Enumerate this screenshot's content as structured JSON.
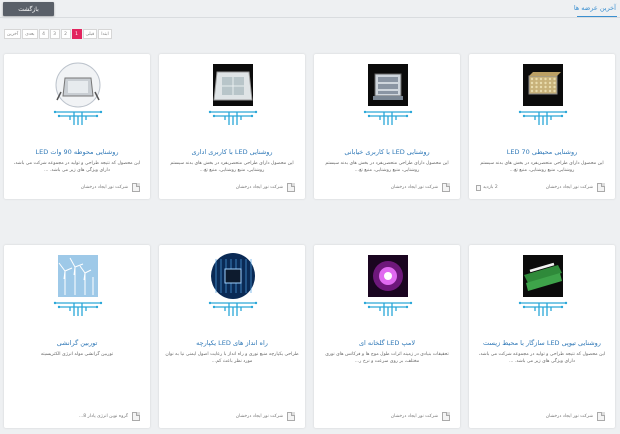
{
  "header": {
    "back_label": "بازگشت",
    "section_title": "آخرین عرضه ها"
  },
  "pagination": [
    "آخرین",
    "بعدی",
    "4",
    "3",
    "2",
    "1",
    "قبلی",
    "ابتدا"
  ],
  "pagination_active": "1",
  "colors": {
    "accent": "#3a8fd0",
    "active_page": "#e2245e",
    "back_button": "#5a6069",
    "title": "#2f78b7"
  },
  "cards": [
    {
      "title": "روشنایی محیطی 70 LED",
      "desc": "این محصول دارای طراحی منحصربفرد در بخش های بدنه سیستم روشنایی، منبع روشنایی، منبع تغ...",
      "company": "شرکت نور ایجاد درخشان",
      "meta": "2 بازدید",
      "image": "led-panel-icon"
    },
    {
      "title": "روشنایی LED با کاربری خیابانی",
      "desc": "این محصول دارای طراحی منحصربفرد در بخش های بدنه سیستم روشنایی، منبع روشنایی، منبع تغ...",
      "company": "شرکت نور ایجاد درخشان",
      "meta": "",
      "image": "street-light-icon"
    },
    {
      "title": "روشنایی LED با کاربری اداری",
      "desc": "این محصول دارای طراحی منحصربفرد در بخش های بدنه سیستم روشنایی، منبع روشنایی، منبع تغ...",
      "company": "شرکت نور ایجاد درخشان",
      "meta": "",
      "image": "office-light-icon"
    },
    {
      "title": "روشنایی محوطه 90 وات LED",
      "desc": "این محصول که نتیجه طراحی و تولید در مجموعه شرکت می باشد، دارای ویژگی های زیر می باشد. ...",
      "company": "شرکت نور ایجاد درخشان",
      "meta": "",
      "image": "floodlight-icon"
    },
    {
      "title": "روشنایی تیوپی LED سازگار با محیط زیست",
      "desc": "این محصول که نتیجه طراحی و تولید در مجموعه شرکت می باشد، دارای ویژگی های زیر می باشد. ...",
      "company": "شرکت نور ایجاد درخشان",
      "meta": "",
      "image": "tube-light-icon"
    },
    {
      "title": "لامپ LED گلخانه ای",
      "desc": "تحقیقات بنیادی در زمینه اثرات طول موج ها و فرکانس های نوری مختلف، بر روی سرعت و نرخ ر...",
      "company": "شرکت نور ایجاد درخشان",
      "meta": "",
      "image": "grow-lamp-icon"
    },
    {
      "title": "راه انداز های LED یکپارچه",
      "desc": "طراحی یکپارچه منبع نوری و راه انداز با رعایت اصول ایمنی نیا به نوان مورد نظر باعث کم...",
      "company": "شرکت نور ایجاد درخشان",
      "meta": "",
      "image": "driver-chip-icon"
    },
    {
      "title": "توربین گرانشی",
      "desc": "توربین گرانشی مولد انرژی الکتریسیته",
      "company": "گروه نوین انرژی پادار 8...",
      "meta": "",
      "image": "wind-turbine-icon"
    }
  ]
}
